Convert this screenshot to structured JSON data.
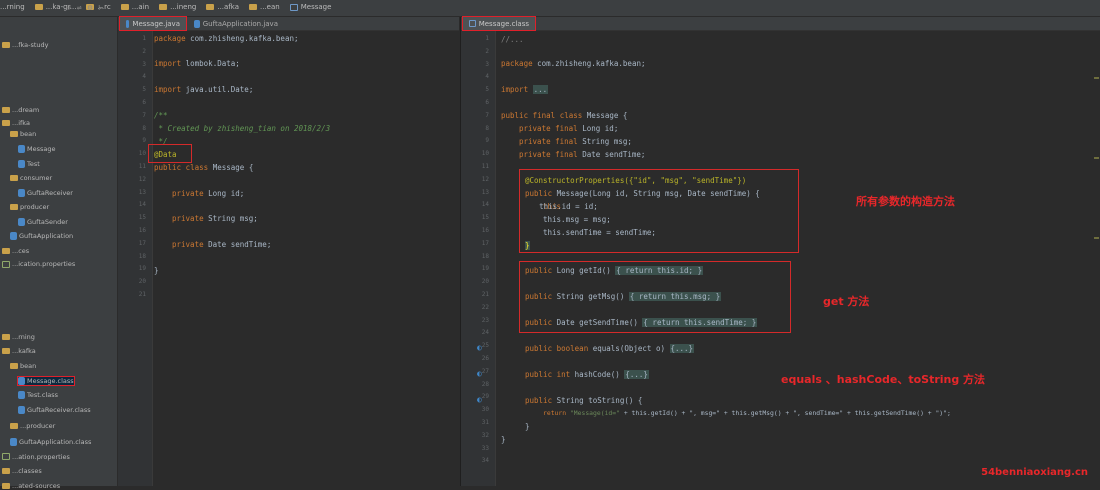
{
  "colors": {
    "editor_bg": "#2b2b2b",
    "panel_bg": "#3c3f41",
    "highlight_box": "#d42a2a",
    "keyword": "#cc7832",
    "string": "#6a8759",
    "annotation": "#bbb529",
    "field": "#9876aa"
  },
  "topbar": {
    "crumbs": [
      "...rning",
      "...ka-gr...",
      "...rc",
      "...ain",
      "...ineng",
      "...afka",
      "...ean",
      "Message"
    ],
    "icon_names": [
      "folder-icon",
      "module-icon",
      "java-file-icon"
    ]
  },
  "sidebar": {
    "items": [
      {
        "label": "...fka-study",
        "indent": 0
      },
      {
        "label": "...dream",
        "indent": 0
      },
      {
        "label": "...ifka",
        "indent": 0
      },
      {
        "label": "bean",
        "indent": 1
      },
      {
        "label": "Message",
        "indent": 2
      },
      {
        "label": "Test",
        "indent": 2
      },
      {
        "label": "consumer",
        "indent": 1
      },
      {
        "label": "GuftaReceiver",
        "indent": 2
      },
      {
        "label": "producer",
        "indent": 1
      },
      {
        "label": "GuftaSender",
        "indent": 2
      },
      {
        "label": "GuftaApplication",
        "indent": 1
      },
      {
        "label": "...ces",
        "indent": 0
      },
      {
        "label": "...ication.properties",
        "indent": 0
      },
      {
        "label": "...rning",
        "indent": 0
      },
      {
        "label": "...kafka",
        "indent": 0
      },
      {
        "label": "bean",
        "indent": 1
      },
      {
        "label": "Message.class",
        "indent": 2,
        "selected": true
      },
      {
        "label": "Test.class",
        "indent": 2
      },
      {
        "label": "GuftaReceiver.class",
        "indent": 2
      },
      {
        "label": "...producer",
        "indent": 1
      },
      {
        "label": "GuftaApplication.class",
        "indent": 1
      },
      {
        "label": "...ation.properties",
        "indent": 0
      },
      {
        "label": "...classes",
        "indent": 0
      },
      {
        "label": "...ated-sources",
        "indent": 0
      }
    ]
  },
  "left_editor": {
    "tabs": [
      {
        "label": "Message.java",
        "active": true
      },
      {
        "label": "GuftaApplication.java",
        "active": false
      }
    ],
    "line_numbers": [
      "1",
      "2",
      "3",
      "4",
      "5",
      "6",
      "7",
      "8",
      "9",
      "10",
      "11",
      "12",
      "13",
      "14",
      "15",
      "16",
      "17",
      "18",
      "19",
      "20",
      "21"
    ],
    "code": {
      "package_kw": "package",
      "package_name": " com.zhisheng.kafka.bean;",
      "import1_kw": "import",
      "import1_name": " lombok.Data;",
      "import2_kw": "import",
      "import2_name": " java.util.Date;",
      "doc_open": "/**",
      "doc_line": " * Created by zhisheng_tian on 2018/2/3",
      "doc_close": " */",
      "annotation": "@Data",
      "class_decl_kw": "public class",
      "class_decl_name": " Message {",
      "field1_kw": "private",
      "field1_rest": " Long id;",
      "field2_kw": "private",
      "field2_rest": " String msg;",
      "field3_kw": "private",
      "field3_rest": " Date sendTime;",
      "close": "}"
    }
  },
  "right_editor": {
    "tabs": [
      {
        "label": "Message.class",
        "active": true
      }
    ],
    "line_numbers": [
      "1",
      "2",
      "3",
      "4",
      "5",
      "6",
      "7",
      "8",
      "9",
      "10",
      "11",
      "12",
      "13",
      "14",
      "15",
      "16",
      "17",
      "18",
      "19",
      "20",
      "21",
      "22",
      "23",
      "24",
      "25",
      "26",
      "27",
      "28",
      "29",
      "30",
      "31",
      "32",
      "33",
      "34"
    ],
    "code": {
      "header_comment": "//...",
      "package_kw": "package",
      "package_name": " com.zhisheng.kafka.bean;",
      "import_kw": "import",
      "import_fold": "...",
      "class_kw": "public final class",
      "class_name": " Message {",
      "field1_kw": "private final",
      "field1_rest": " Long id;",
      "field2_kw": "private final",
      "field2_rest": " String msg;",
      "field3_kw": "private final",
      "field3_rest": " Date sendTime;",
      "ctor_annotation": "@ConstructorProperties({\"id\", \"msg\", \"sendTime\"})",
      "ctor_kw": "public",
      "ctor_rest": " Message(Long id, String msg, Date sendTime) {",
      "ctor_body1": "this.id = id;",
      "ctor_body2": "this.msg = msg;",
      "ctor_body3": "this.sendTime = sendTime;",
      "ctor_close": "}",
      "getter1_kw": "public",
      "getter1_rest": " Long getId() ",
      "getter1_fold": "{ return this.id; }",
      "getter2_kw": "public",
      "getter2_rest": " String getMsg() ",
      "getter2_fold": "{ return this.msg; }",
      "getter3_kw": "public",
      "getter3_rest": " Date getSendTime() ",
      "getter3_fold": "{ return this.sendTime; }",
      "equals_kw": "public boolean",
      "equals_rest": " equals(Object o) ",
      "equals_fold": "{...}",
      "hash_kw": "public int",
      "hash_rest": " hashCode() ",
      "hash_fold": "{...}",
      "tostring_kw": "public",
      "tostring_rest": " String toString() {",
      "tostring_ret_kw": "return",
      "tostring_ret_str1": " \"Message(id=\"",
      "tostring_ret_rest": " + this.getId() + \", msg=\" + this.getMsg() + \", sendTime=\" + this.getSendTime() + \")\";",
      "tostring_close": "}",
      "class_close": "}"
    }
  },
  "annotations": {
    "constructor_note": "所有参数的构造方法",
    "getter_note": "get 方法",
    "methods_note": "equals 、hashCode、toString 方法"
  },
  "watermark": "54benniaoxiang.cn"
}
